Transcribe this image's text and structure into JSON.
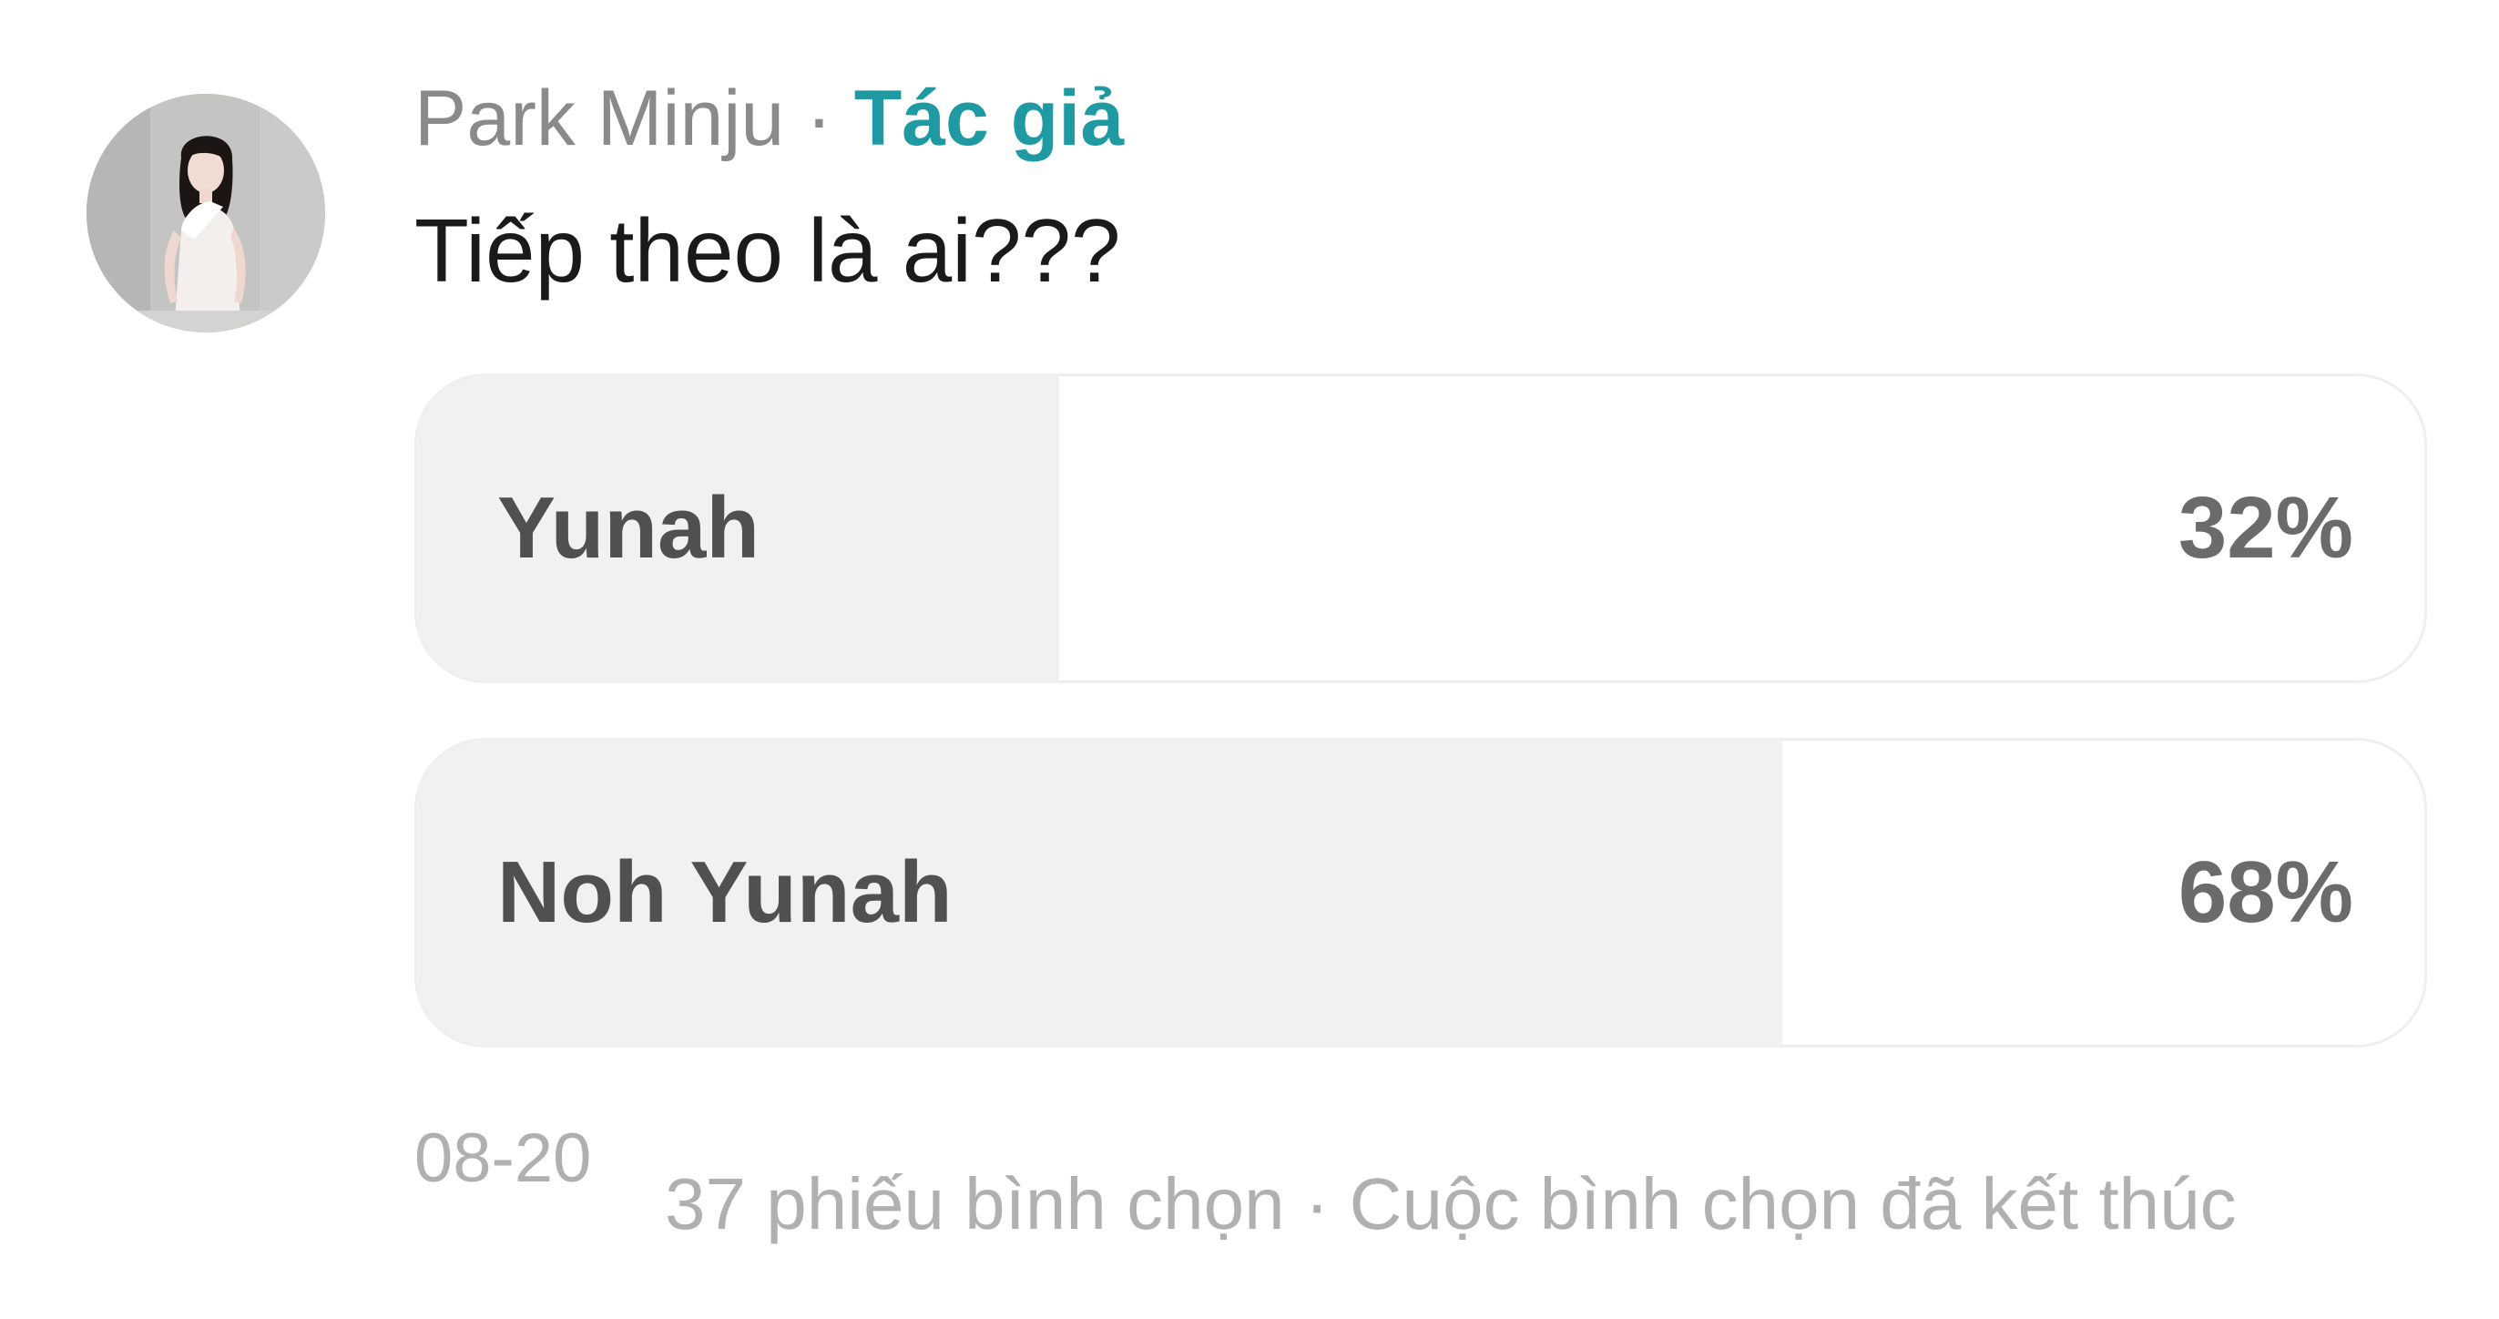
{
  "author": {
    "name": "Park Minju",
    "separator": "·",
    "badge": "Tác giả",
    "badge_color": "#1f9aa3"
  },
  "post": {
    "text": "Tiếp theo là ai???"
  },
  "poll": {
    "options": [
      {
        "label": "Yunah",
        "percent_text": "32%",
        "percent": 32
      },
      {
        "label": "Noh Yunah",
        "percent_text": "68%",
        "percent": 68
      }
    ],
    "fill_color": "#f1f1f1"
  },
  "footer": {
    "date": "08-20",
    "stats": "37 phiếu bình chọn · Cuộc bình chọn đã kết thúc"
  },
  "icons": {
    "avatar": "user-photo-avatar"
  }
}
